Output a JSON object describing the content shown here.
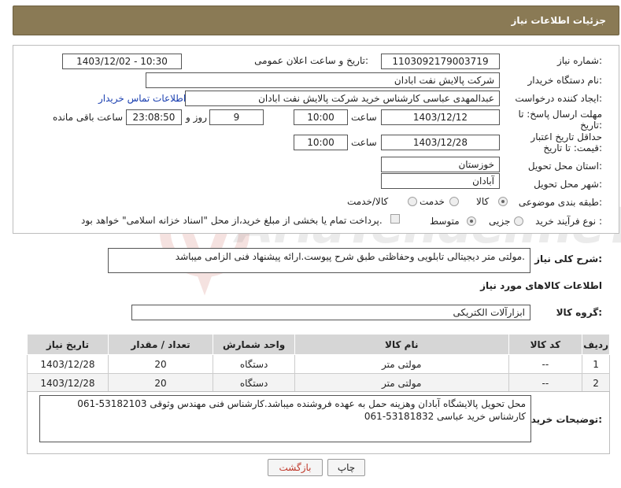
{
  "header": {
    "title": "جزئیات اطلاعات نیاز"
  },
  "fields": {
    "need_number_label": "شماره نیاز:",
    "need_number": "1103092179003719",
    "announce_label": "تاریخ و ساعت اعلان عمومی:",
    "announce_value": "1403/12/02 - 10:30",
    "buyer_org_label": "نام دستگاه خریدار:",
    "buyer_org": "شرکت پالایش نفت ابادان",
    "creator_label": "ایجاد کننده درخواست:",
    "creator": "عبدالمهدی  عباسی کارشناس خرید شرکت پالایش نفت ابادان",
    "contact_link": "اطلاعات تماس خریدار",
    "deadline_label": "مهلت ارسال پاسخ: تا تاریخ:",
    "deadline_date": "1403/12/12",
    "time_label": "ساعت",
    "deadline_time": "10:00",
    "days_value": "9",
    "days_label": "روز و",
    "remaining_time": "23:08:50",
    "remaining_label": "ساعت باقی مانده",
    "validity_label": "حداقل تاریخ اعتبار قیمت: تا تاریخ:",
    "validity_date": "1403/12/28",
    "validity_time": "10:00",
    "province_label": "استان محل تحویل:",
    "province": "خوزستان",
    "city_label": "شهر محل تحویل:",
    "city": "آبادان",
    "category_label": "طبقه بندی موضوعی:",
    "category_options": [
      "کالا",
      "خدمت",
      "کالا/خدمت"
    ],
    "process_label": "نوع فرآیند خرید :",
    "process_options": [
      "جزیی",
      "متوسط"
    ],
    "payment_note": "پرداخت تمام یا بخشی از مبلغ خرید،از محل \"اسناد خزانه اسلامی\" خواهد بود."
  },
  "description": {
    "label": "شرح کلی نیاز:",
    "text": "مولتی متر دیجیتالی تابلویی وحفاظتی طبق شرح پیوست.ارائه پیشنهاد فنی الزامی میباشد."
  },
  "goods_section": {
    "title": "اطلاعات کالاهای مورد نیاز",
    "group_label": "گروه کالا:",
    "group_value": "ابزارآلات الکتریکی"
  },
  "table": {
    "headers": [
      "ردیف",
      "کد کالا",
      "نام کالا",
      "واحد شمارش",
      "تعداد / مقدار",
      "تاریخ نیاز"
    ],
    "rows": [
      [
        "1",
        "--",
        "مولتی متر",
        "دستگاه",
        "20",
        "1403/12/28"
      ],
      [
        "2",
        "--",
        "مولتی متر",
        "دستگاه",
        "20",
        "1403/12/28"
      ]
    ]
  },
  "buyer_notes": {
    "label": "توضیحات خریدار:",
    "text": "محل تحویل پالایشگاه آبادان وهزینه حمل به عهده فروشنده میباشد.کارشناس فنی مهندس وثوقی 53182103-061 کارشناس خرید عباسی 53181832-061"
  },
  "buttons": {
    "print": "چاپ",
    "back": "بازگشت"
  },
  "watermark": {
    "text": "AriaTender.neT"
  },
  "colors": {
    "header_bg": "#8a7a55",
    "link": "#1a3fb0",
    "back_text": "#c0392b"
  }
}
